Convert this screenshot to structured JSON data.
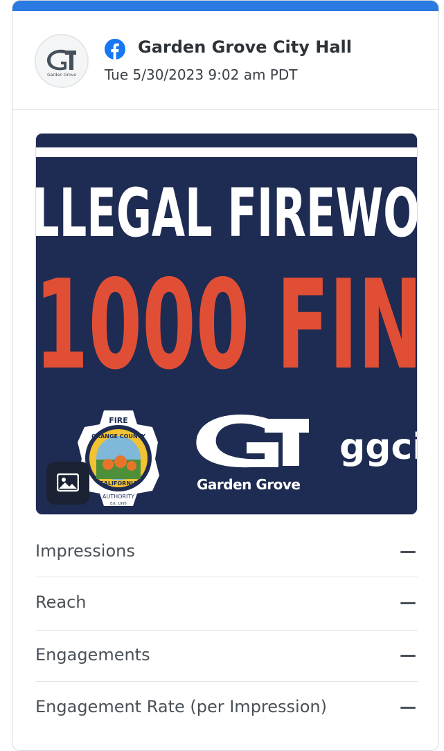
{
  "post": {
    "account_name": "Garden Grove City Hall",
    "timestamp": "Tue 5/30/2023 9:02 am PDT",
    "network_icon": "facebook-icon",
    "avatar_text": "Garden Grove"
  },
  "media": {
    "headline_line1": "LLEGAL FIREWO",
    "headline_line2": "1000 FIN",
    "logo_text": "Garden Grove",
    "url_fragment": "ggci",
    "fire_seal_text": "FIRE",
    "seal_ring_text": "ORANGE COUNTY",
    "seal_state_text": "CALIFORNIA",
    "seal_bottom_text": "AUTHORITY",
    "seal_est": "Est. 1995",
    "media_type_icon": "image-icon",
    "colors": {
      "background": "#1e2b52",
      "fine_red": "#e04f35",
      "white": "#ffffff"
    }
  },
  "metrics": [
    {
      "label": "Impressions",
      "value": "—"
    },
    {
      "label": "Reach",
      "value": "—"
    },
    {
      "label": "Engagements",
      "value": "—"
    },
    {
      "label": "Engagement Rate (per Impression)",
      "value": "—"
    }
  ],
  "colors": {
    "accent": "#2a7ae2",
    "facebook": "#1877f2"
  }
}
